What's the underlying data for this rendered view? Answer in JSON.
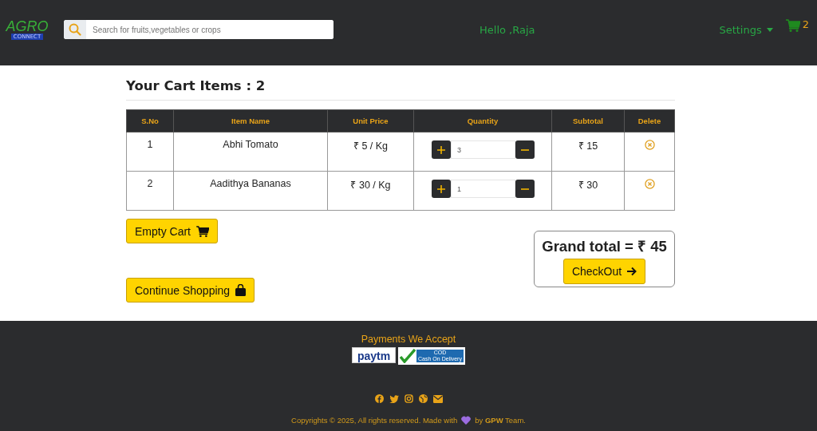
{
  "header": {
    "logo": {
      "title": "AGRO",
      "subtitle": "CONNECT"
    },
    "search": {
      "placeholder": "Search for fruits,vegetables or crops"
    },
    "greeting": "Hello ,Raja",
    "settings": "Settings",
    "cart_count": "2"
  },
  "cart": {
    "heading": "Your Cart Items : 2",
    "columns": [
      "S.No",
      "Item Name",
      "Unit Price",
      "Quantity",
      "Subtotal",
      "Delete"
    ],
    "rows": [
      {
        "sno": "1",
        "name": "Abhi Tomato",
        "price": "₹ 5 / Kg",
        "quantity": "3",
        "subtotal": "₹ 15"
      },
      {
        "sno": "2",
        "name": "Aadithya Bananas",
        "price": "₹ 30 / Kg",
        "quantity": "1",
        "subtotal": "₹ 30"
      }
    ],
    "empty_button": "Empty Cart",
    "continue_button": "Continue Shopping",
    "grand_total": "Grand total = ₹ 45",
    "checkout_button": "CheckOut"
  },
  "footer": {
    "payments_title": "Payments We Accept",
    "payment_methods": [
      {
        "kind": "paytm",
        "label": "paytm"
      },
      {
        "kind": "cod",
        "label": "COD",
        "sublabel": "Cash On Delivery"
      }
    ],
    "copyright_before": "Copyrights © 2025, All rights reserved. Made with",
    "copyright_after": "by **GPW** Team."
  }
}
